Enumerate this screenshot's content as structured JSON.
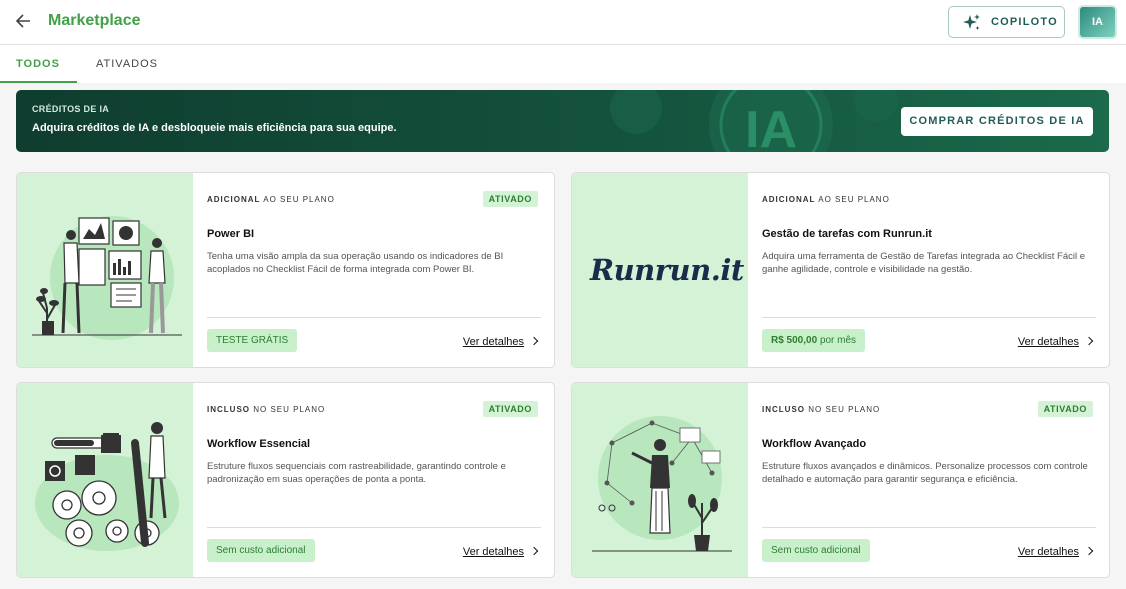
{
  "header": {
    "back_icon": "arrow-left-icon",
    "title": "Marketplace",
    "copilot_label": "COPILOTO",
    "copilot_icon": "sparkles-icon",
    "avatar_label": "IA",
    "accent_color": "#43a047"
  },
  "tabs": [
    {
      "label": "TODOS",
      "active": true
    },
    {
      "label": "ATIVADOS",
      "active": false
    }
  ],
  "banner": {
    "eyebrow": "CRÉDITOS DE IA",
    "message": "Adquira créditos de IA e desbloqueie mais eficiência para sua equipe.",
    "button_label": "COMPRAR CRÉDITOS DE IA",
    "coin_text": "IA"
  },
  "cards": [
    {
      "plan_type": "ADICIONAL",
      "plan_suffix": "AO SEU PLANO",
      "badge": "ATIVADO",
      "title": "Power BI",
      "description": "Tenha uma visão ampla da sua operação usando os indicadores de BI acoplados no Checklist Fácil de forma integrada com Power BI.",
      "price_bold": "",
      "price_text": "TESTE GRÁTIS",
      "details_label": "Ver detalhes"
    },
    {
      "plan_type": "ADICIONAL",
      "plan_suffix": "AO SEU PLANO",
      "badge": "",
      "title": "Gestão de tarefas com Runrun.it",
      "description": "Adquira uma ferramenta de Gestão de Tarefas integrada ao Checklist Fácil e ganhe agilidade, controle e visibilidade na gestão.",
      "logo_text": "Runrun.it",
      "price_bold": "R$ 500,00",
      "price_text": "por mês",
      "details_label": "Ver detalhes"
    },
    {
      "plan_type": "INCLUSO",
      "plan_suffix": "NO SEU PLANO",
      "badge": "ATIVADO",
      "title": "Workflow Essencial",
      "description": "Estruture fluxos sequenciais com rastreabilidade, garantindo controle e padronização em suas operações de ponta a ponta.",
      "price_bold": "",
      "price_text": "Sem custo adicional",
      "details_label": "Ver detalhes"
    },
    {
      "plan_type": "INCLUSO",
      "plan_suffix": "NO SEU PLANO",
      "badge": "ATIVADO",
      "title": "Workflow Avançado",
      "description": "Estruture fluxos avançados e dinâmicos. Personalize processos com controle detalhado e automação para garantir segurança e eficiência.",
      "price_bold": "",
      "price_text": "Sem custo adicional",
      "details_label": "Ver detalhes"
    }
  ]
}
